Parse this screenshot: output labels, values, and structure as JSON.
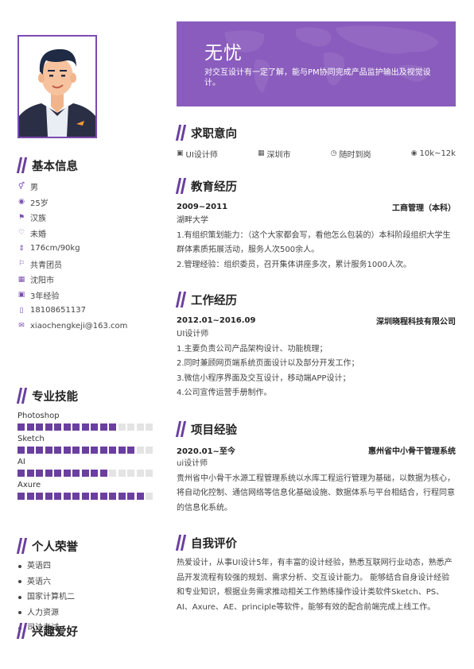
{
  "name": "无忧",
  "intro": "对交互设计有一定了解，能与PM协同完成产品监护输出及视觉设计。",
  "left": {
    "basic_title": "基本信息",
    "basic": [
      {
        "icon": "gender-icon",
        "glyph": "⚥",
        "text": "男"
      },
      {
        "icon": "age-icon",
        "glyph": "◉",
        "text": "25岁"
      },
      {
        "icon": "ethnicity-icon",
        "glyph": "⚑",
        "text": "汉族"
      },
      {
        "icon": "heart-icon",
        "glyph": "♡",
        "text": "未婚"
      },
      {
        "icon": "height-icon",
        "glyph": "⇕",
        "text": "176cm/90kg"
      },
      {
        "icon": "flag-icon",
        "glyph": "⚐",
        "text": "共青团员"
      },
      {
        "icon": "city-icon",
        "glyph": "▦",
        "text": "沈阳市"
      },
      {
        "icon": "briefcase-icon",
        "glyph": "▣",
        "text": "3年经验"
      },
      {
        "icon": "phone-icon",
        "glyph": "▯",
        "text": "18108651137"
      },
      {
        "icon": "email-icon",
        "glyph": "✉",
        "text": "xiaochengkeji@163.com"
      }
    ],
    "skills_title": "专业技能",
    "skills": [
      {
        "name": "Photoshop",
        "level": 0.75
      },
      {
        "name": "Sketch",
        "level": 0.85
      },
      {
        "name": "AI",
        "level": 0.65
      },
      {
        "name": "Axure",
        "level": 0.9
      }
    ],
    "honors_title": "个人荣誉",
    "honors": [
      "英语四",
      "英语六",
      "国家计算机二",
      "人力资源",
      "司法考试"
    ],
    "hobbies_title": "兴趣爱好"
  },
  "intent": {
    "title": "求职意向",
    "position": "UI设计师",
    "city": "深圳市",
    "availability": "随时到岗",
    "salary": "10k~12k"
  },
  "education": {
    "title": "教育经历",
    "period": "2009~2011",
    "major": "工商管理（本科）",
    "school": "湖畔大学",
    "lines": [
      "1.有组织策划能力：（这个大家都会写，看他怎么包装的）本科阶段组织大学生群体素质拓展活动，服务人次500余人。",
      "2.管理经验：组织委员，召开集体讲座多次，累计服务1000人次。"
    ]
  },
  "work": {
    "title": "工作经历",
    "period": "2012.01~2016.09",
    "company": "深圳晓程科技有限公司",
    "role": "UI设计师",
    "lines": [
      "1.主要负责公司产品架构设计、功能梳理；",
      "2.同时兼顾网页端系统页面设计以及部分开发工作；",
      "3.微信小程序界面及交互设计，移动端APP设计；",
      "4.公司宣传运营手册制作。"
    ]
  },
  "project": {
    "title": "项目经验",
    "period": "2020.01~至今",
    "name": "惠州省中小骨干管理系统",
    "role": "ui设计师",
    "desc": "贵州省中小骨干水源工程管理系统以水库工程运行管理为基础，以数据为核心，将自动化控制、通信网络等信息化基础设施、数据体系与平台相结合，行程同意的信息化系统。"
  },
  "self": {
    "title": "自我评价",
    "desc": "热爱设计，从事UI设计5年，有丰富的设计经验，熟悉互联网行业动态，熟悉产品开发流程有较强的规划、需求分析、交互设计能力。 能够结合自身设计经验和专业知识，根据业务需求推动相关工作熟练操作设计类软件Sketch、PS、AI、Axure、AE、principle等软件，能够有效的配合前端完成上线工作。"
  },
  "colors": {
    "accent": "#6b3fa0",
    "banner": "#8a5cbd",
    "dot_off": "#e4e4e4"
  }
}
